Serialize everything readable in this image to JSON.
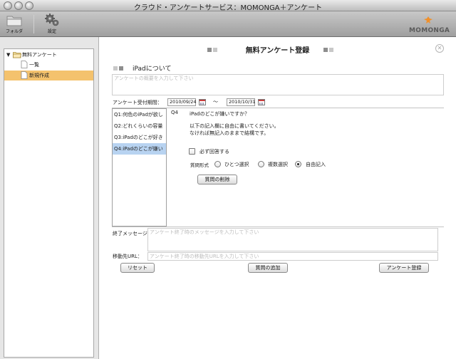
{
  "window": {
    "title": "クラウド・アンケートサービス：MOMONGA＋アンケート"
  },
  "toolbar": {
    "folder_label": "フォルダ",
    "settings_label": "設定",
    "logo_text": "MOMONGA",
    "logo_color": "#f0902a"
  },
  "sidebar": {
    "root_label": "無料アンケート",
    "items": [
      {
        "label": "一覧"
      },
      {
        "label": "新規作成",
        "selected": true
      }
    ],
    "selected_color": "#f4c26d"
  },
  "form": {
    "heading": "無料アンケート登録",
    "survey_title": "iPadについて",
    "overview_placeholder": "アンケートの概要を入力して下さい",
    "period_label": "アンケート受付期間：",
    "start_date": "2010/09/24",
    "date_separator": "〜",
    "end_date": "2010/10/31",
    "questions": [
      {
        "label": "Q1:何色のiPadが欲し"
      },
      {
        "label": "Q2:どれくらいの容量"
      },
      {
        "label": "Q3:iPadのどこが好き"
      },
      {
        "label": "Q4:iPadのどこが嫌い",
        "selected": true
      }
    ],
    "question_editor": {
      "number": "Q4",
      "question_text": "iPadのどこが嫌いですか？",
      "instruction_line1": "以下の記入欄に自由に書いてください。",
      "instruction_line2": "なければ無記入のままで結構です。",
      "required_label": "必ず回答する",
      "required_checked": false,
      "format_label": "質問形式",
      "formats": [
        {
          "label": "ひとつ選択",
          "checked": false
        },
        {
          "label": "複数選択",
          "checked": false
        },
        {
          "label": "自由記入",
          "checked": true
        }
      ],
      "delete_button": "質問の削除"
    },
    "end_message_label": "終了メッセージ",
    "end_message_placeholder": "アンケート終了時のメッセージを入力して下さい",
    "redirect_label": "移動先URL：",
    "redirect_placeholder": "アンケート終了時の移動先URLを入力して下さい",
    "reset_button": "リセット",
    "add_question_button": "質問の追加",
    "register_button": "アンケート登録"
  }
}
